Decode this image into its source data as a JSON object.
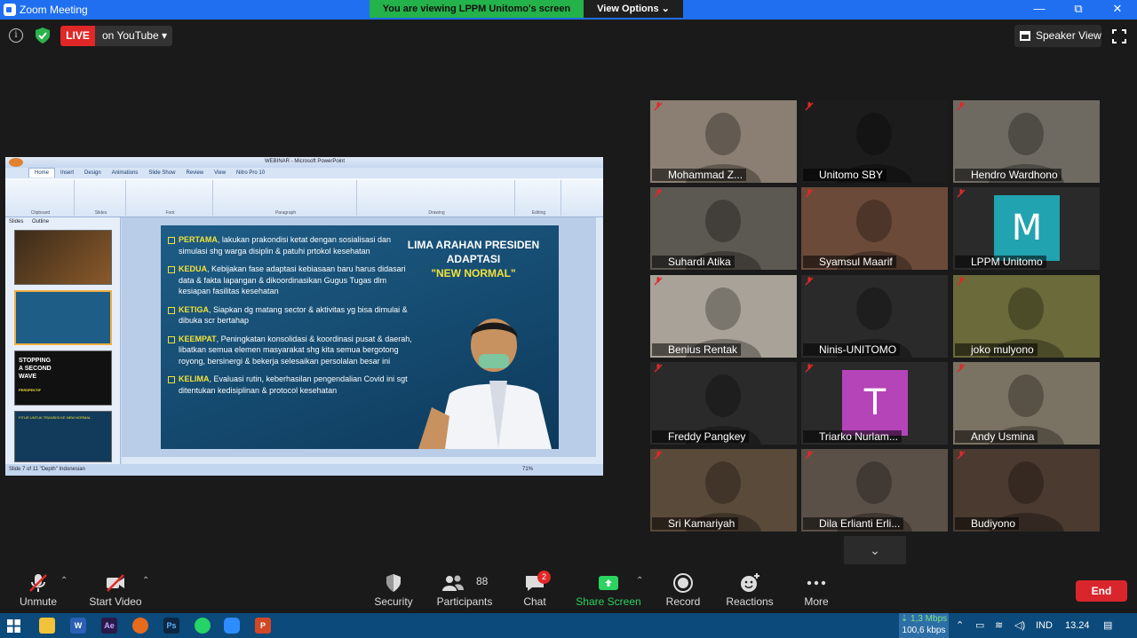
{
  "window": {
    "title": "Zoom Meeting",
    "viewing_banner": "You are viewing LPPM Unitomo's screen",
    "view_options": "View Options ⌄",
    "minimize": "—",
    "restore": "⧉",
    "close": "✕"
  },
  "topbar": {
    "live": "LIVE",
    "stream_target": "on YouTube ▾",
    "speaker_view": "Speaker View"
  },
  "powerpoint": {
    "window_title": "WEBINAR - Microsoft PowerPoint",
    "tabs": [
      "Home",
      "Insert",
      "Design",
      "Animations",
      "Slide Show",
      "Review",
      "View",
      "Nitro Pro 10"
    ],
    "ribbon_groups": [
      "Clipboard",
      "Slides",
      "Font",
      "Paragraph",
      "Drawing",
      "Editing"
    ],
    "panel_tabs": [
      "Slides",
      "Outline"
    ],
    "status": "Slide 7 of 11   \"Depth\"   Indonesian",
    "zoom": "71%",
    "thumb3": {
      "l1": "STOPPING",
      "l2": "A SECOND",
      "l3": "WAVE",
      "sub": "PERSPEKTIF"
    },
    "thumb4": {
      "title": "FITUR UNTUK TRANSISI KE NEW NORMAL"
    },
    "slide": {
      "title_l1": "LIMA ARAHAN PRESIDEN",
      "title_l2": "ADAPTASI",
      "title_l3": "\"NEW NORMAL\"",
      "b1_head": "PERTAMA",
      "b1_text": ", lakukan prakondisi ketat dengan sosialisasi dan simulasi shg warga disiplin & patuhi prtokol kesehatan",
      "b2_head": "KEDUA",
      "b2_text": ", Kebijakan fase adaptasi kebiasaan baru harus didasari data & fakta lapangan & dikoordinasikan Gugus Tugas dlm kesiapan fasilitas kesehatan",
      "b3_head": "KETIGA",
      "b3_text": ", Siapkan dg matang sector & aktivitas yg bisa dimulai & dibuka scr bertahap",
      "b4_head": "KEEMPAT",
      "b4_text": ", Peningkatan konsolidasi & koordinasi pusat & daerah, libatkan semua elemen masyarakat shg kita semua bergotong royong, bersinergi & bekerja selesaikan persolalan besar ini",
      "b5_head": "KELIMA",
      "b5_text": ", Evaluasi rutin, keberhasilan pengendalian Covid ini sgt ditentukan kedisiplinan & protocol kesehatan"
    }
  },
  "participants_gallery": [
    {
      "name": "Mohammad Z...",
      "bg": "#8a7f72"
    },
    {
      "name": "Unitomo SBY",
      "bg": "#1c1c1c"
    },
    {
      "name": "Hendro Wardhono",
      "bg": "#6e6a62"
    },
    {
      "name": "Suhardi Atika",
      "bg": "#5c5852"
    },
    {
      "name": "Syamsul Maarif",
      "bg": "#6b4a3a"
    },
    {
      "name": "LPPM Unitomo",
      "bg": "#2a2a2a",
      "initial": "M",
      "initial_color": "#21a3b0"
    },
    {
      "name": "Benius Rentak",
      "bg": "#a9a298"
    },
    {
      "name": "Ninis-UNITOMO",
      "bg": "#2a2a2a"
    },
    {
      "name": "joko mulyono",
      "bg": "#6a6a3a"
    },
    {
      "name": "Freddy Pangkey",
      "bg": "#2a2a2a"
    },
    {
      "name": "Triarko Nurlam...",
      "bg": "#2a2a2a",
      "initial": "T",
      "initial_color": "#b544b8"
    },
    {
      "name": "Andy Usmina",
      "bg": "#7a7262"
    },
    {
      "name": "Sri Kamariyah",
      "bg": "#5a4a3a"
    },
    {
      "name": "Dila Erlianti Erli...",
      "bg": "#5a5048"
    },
    {
      "name": "Budiyono",
      "bg": "#4a3a30"
    }
  ],
  "controls": {
    "unmute": "Unmute",
    "start_video": "Start Video",
    "security": "Security",
    "participants": "Participants",
    "participant_count": "88",
    "chat": "Chat",
    "chat_badge": "2",
    "share_screen": "Share Screen",
    "record": "Record",
    "reactions": "Reactions",
    "more": "More",
    "end": "End"
  },
  "taskbar": {
    "net_down": "⇣ 1,3 Mbps",
    "net_up": "100,6 kbps",
    "lang": "IND",
    "time": "13.24"
  },
  "colors": {
    "zoom_blue": "#1f6ff0",
    "live_red": "#e02828",
    "share_green": "#2bd35f",
    "active_speaker": "#c8e84a"
  }
}
